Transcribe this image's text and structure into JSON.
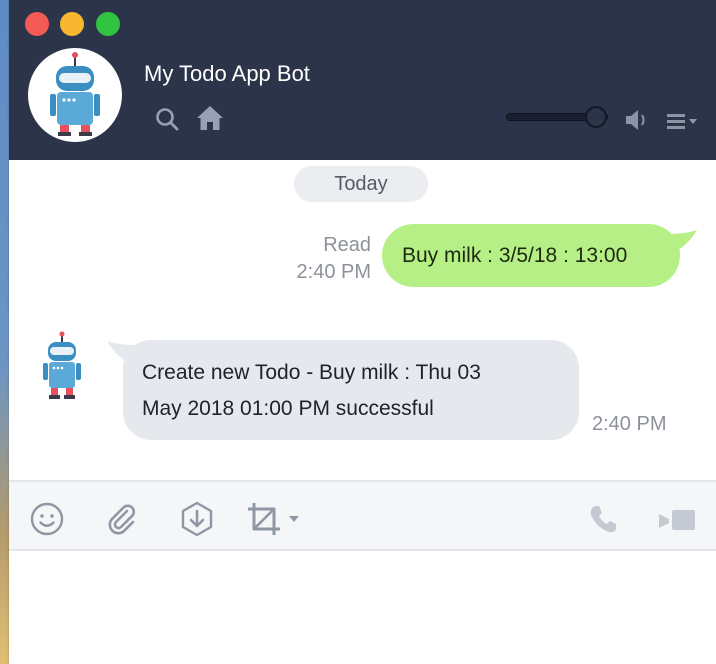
{
  "window": {
    "controls": [
      "close",
      "minimize",
      "maximize"
    ]
  },
  "header": {
    "title": "My Todo App Bot",
    "avatar_icon": "robot-icon",
    "icons": [
      "search-icon",
      "home-icon"
    ],
    "volume": 0.88,
    "right_icons": [
      "speaker-icon",
      "menu-icon"
    ]
  },
  "chat": {
    "date_label": "Today",
    "messages": [
      {
        "direction": "outgoing",
        "text": "Buy milk : 3/5/18 : 13:00",
        "status": "Read",
        "time": "2:40 PM",
        "bubble_color": "#b7ef87"
      },
      {
        "direction": "incoming",
        "line1": "Create new Todo - Buy milk : Thu 03",
        "line2": "May 2018 01:00 PM successful",
        "time": "2:40 PM",
        "bubble_color": "#e5e8ec"
      }
    ]
  },
  "toolbar": {
    "left_icons": [
      "emoji-icon",
      "attach-icon",
      "download-icon",
      "crop-icon"
    ],
    "right_icons": [
      "phone-icon",
      "video-icon"
    ]
  },
  "compose": {
    "value": "",
    "placeholder": ""
  },
  "colors": {
    "header_bg": "#2c344a",
    "accent_green": "#b7ef87",
    "close": "#f25a55",
    "minimize": "#f8b730",
    "maximize": "#30c440"
  }
}
